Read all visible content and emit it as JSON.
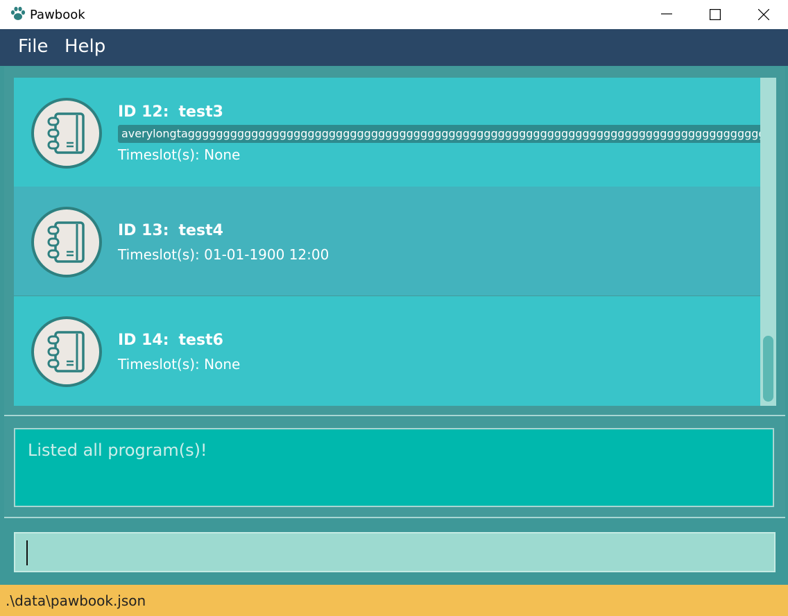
{
  "window": {
    "title": "Pawbook",
    "app_icon": "paw-icon",
    "controls": [
      "minimize-icon",
      "maximize-icon",
      "close-icon"
    ]
  },
  "menu": {
    "file_label": "File",
    "help_label": "Help"
  },
  "programs": [
    {
      "id_label": "ID 12:",
      "name": "test3",
      "tag": "averylongtaggggggggggggggggggggggggggggggggggggggggggggggggggggggggggggggggggggggggggggggggggggggg",
      "timeslot": "Timeslot(s): None",
      "icon": "notebook-icon"
    },
    {
      "id_label": "ID 13:",
      "name": "test4",
      "timeslot": "Timeslot(s): 01-01-1900 12:00",
      "icon": "notebook-icon"
    },
    {
      "id_label": "ID 14:",
      "name": "test6",
      "timeslot": "Timeslot(s): None",
      "icon": "notebook-icon"
    }
  ],
  "result": {
    "message": "Listed all program(s)!"
  },
  "command": {
    "value": ""
  },
  "status": {
    "file_path": ".\\data\\pawbook.json"
  },
  "colors": {
    "menubar": "#2a4766",
    "card_primary": "#39c4c9",
    "card_alt": "#43b3bd",
    "result_bg": "#00b8ad",
    "command_bg": "#9ddad0",
    "statusbar": "#f3bf53"
  }
}
